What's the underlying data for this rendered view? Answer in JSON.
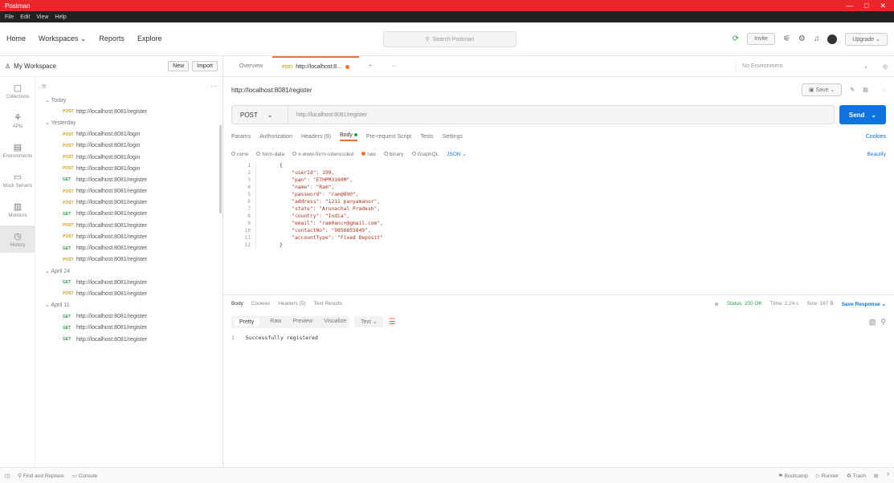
{
  "titlebar": {
    "title": "Postman",
    "controls": [
      "—",
      "□",
      "✕"
    ]
  },
  "menubar": [
    "File",
    "Edit",
    "View",
    "Help"
  ],
  "header": {
    "nav": [
      "Home",
      "Workspaces ⌄",
      "Reports",
      "Explore"
    ],
    "search_placeholder": "Search Postman",
    "invite_label": "Invite",
    "upgrade_label": "Upgrade ⌄"
  },
  "workspace": {
    "name": "My Workspace",
    "new_label": "New",
    "import_label": "Import"
  },
  "sidebar_icons": [
    {
      "label": "Collections",
      "glyph": "▢",
      "icon": "collections-icon"
    },
    {
      "label": "APIs",
      "glyph": "⚘",
      "icon": "apis-icon"
    },
    {
      "label": "Environments",
      "glyph": "▤",
      "icon": "environments-icon"
    },
    {
      "label": "Mock Servers",
      "glyph": "▭",
      "icon": "mock-servers-icon"
    },
    {
      "label": "Monitors",
      "glyph": "▥",
      "icon": "monitors-icon"
    },
    {
      "label": "History",
      "glyph": "◷",
      "icon": "history-icon"
    }
  ],
  "history": [
    {
      "type": "group",
      "label": "⌄  Today"
    },
    {
      "type": "item",
      "method": "POST",
      "url": "http://localhost:8081/register"
    },
    {
      "type": "group",
      "label": "⌄  Yesterday"
    },
    {
      "type": "item",
      "method": "POST",
      "url": "http://localhost:8081/login"
    },
    {
      "type": "item",
      "method": "POST",
      "url": "http://localhost:8081/login"
    },
    {
      "type": "item",
      "method": "POST",
      "url": "http://localhost:8081/login"
    },
    {
      "type": "item",
      "method": "POST",
      "url": "http://localhost:8081/login"
    },
    {
      "type": "item",
      "method": "GET",
      "url": "http://localhost:8081/register"
    },
    {
      "type": "item",
      "method": "POST",
      "url": "http://localhost:8081/register"
    },
    {
      "type": "item",
      "method": "POST",
      "url": "http://localhost:8081/register"
    },
    {
      "type": "item",
      "method": "GET",
      "url": "http://localhost:8081/register"
    },
    {
      "type": "item",
      "method": "POST",
      "url": "http://localhost:8081/register"
    },
    {
      "type": "item",
      "method": "POST",
      "url": "http://localhost:8081/register"
    },
    {
      "type": "item",
      "method": "GET",
      "url": "http://localhost:8081/register"
    },
    {
      "type": "item",
      "method": "POST",
      "url": "http://localhost:8081/register"
    },
    {
      "type": "group",
      "label": "⌄  April 24"
    },
    {
      "type": "item",
      "method": "GET",
      "url": "http://localhost:8081/register"
    },
    {
      "type": "item",
      "method": "POST",
      "url": "http://localhost:8081/register"
    },
    {
      "type": "group",
      "label": "⌄  April 11"
    },
    {
      "type": "item",
      "method": "GET",
      "url": "http://localhost:8081/register"
    },
    {
      "type": "item",
      "method": "GET",
      "url": "http://localhost:8081/register"
    },
    {
      "type": "item",
      "method": "GET",
      "url": "http://localhost:8081/register"
    }
  ],
  "tabs": {
    "overview": "Overview",
    "active_method": "POST",
    "active_label": "http://localhost:8...",
    "plus": "+",
    "more": "···",
    "environment": "No Environment"
  },
  "request": {
    "title": "http://localhost:8081/register",
    "save_label": "Save",
    "method": "POST",
    "url": "http://localhost:8081/register",
    "send_label": "Send",
    "tabs": [
      "Params",
      "Authorization",
      "Headers (9)",
      "Body",
      "Pre-request Script",
      "Tests",
      "Settings"
    ],
    "active_tab": "Body",
    "cookies_label": "Cookies",
    "body_options": [
      "none",
      "form-data",
      "x-www-form-urlencoded",
      "raw",
      "binary",
      "GraphQL"
    ],
    "body_selected": "raw",
    "format": "JSON ⌄",
    "beautify_label": "Beautify"
  },
  "editor_lines": [
    "{",
    "    \"userId\": 199,",
    "    \"pan\": \"ETHPM3160M\",",
    "    \"name\": \"Ram\",",
    "    \"password\": \"ram@890\",",
    "    \"address\": \"1211 panyamanor\",",
    "    \"state\": \"Arunachal Pradesh\",",
    "    \"country\": \"India\",",
    "    \"email\": \"ram0anc+@gmail.com\",",
    "    \"contactNo\": \"9856855849\",",
    "    \"accountType\": \"Fixed Deposit\"",
    "}"
  ],
  "response": {
    "tabs": [
      "Body",
      "Cookies",
      "Headers (5)",
      "Test Results"
    ],
    "status": "Status: 200 OK",
    "time": "Time: 2.24 s",
    "size": "Size: 167 B",
    "save_label": "Save Response ⌄",
    "views": [
      "Pretty",
      "Raw",
      "Preview",
      "Visualize"
    ],
    "active_view": "Pretty",
    "format": "Text ⌄",
    "line_no": "1",
    "body": "Successfully registered"
  },
  "statusbar": {
    "left": [
      "Find and Replace",
      "Console"
    ],
    "right": [
      "Bootcamp",
      "Runner",
      "Trash"
    ]
  }
}
